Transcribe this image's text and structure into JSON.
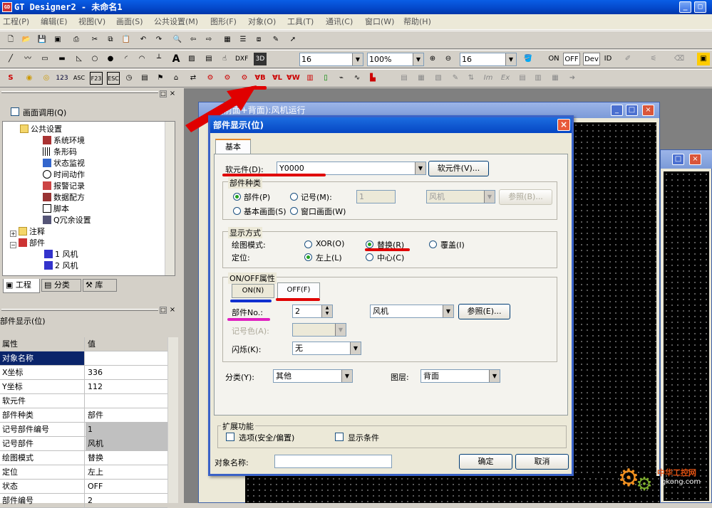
{
  "app": {
    "title": "GT Designer2 - 未命名1",
    "icon_label": "GD",
    "controls": [
      "_",
      "□",
      "×"
    ]
  },
  "menu": [
    "工程(P)",
    "编辑(E)",
    "视图(V)",
    "画面(S)",
    "公共设置(M)",
    "图形(F)",
    "对象(O)",
    "工具(T)",
    "通讯(C)",
    "窗口(W)",
    "帮助(H)"
  ],
  "toolbar2": {
    "font_size": "16",
    "zoom": "100%",
    "size2": "16",
    "on_label": "ON",
    "off_label": "OFF",
    "dev_label": "Dev",
    "id_label": "ID"
  },
  "toolbar3_text": [
    "S",
    "123",
    "ASC",
    "F23",
    "ESC"
  ],
  "left_panel": {
    "screen_call_label": "画面调用(Q)",
    "tree": [
      {
        "label": "公共设置",
        "level": 1
      },
      {
        "label": "系统环境",
        "level": 2
      },
      {
        "label": "条形码",
        "level": 2
      },
      {
        "label": "状态监视",
        "level": 2
      },
      {
        "label": "时间动作",
        "level": 2
      },
      {
        "label": "报警记录",
        "level": 2
      },
      {
        "label": "数据配方",
        "level": 2
      },
      {
        "label": "脚本",
        "level": 2
      },
      {
        "label": "Q冗余设置",
        "level": 2
      },
      {
        "label": "注释",
        "level": 1
      },
      {
        "label": "部件",
        "level": 1
      },
      {
        "label": "1 风机",
        "level": 2
      },
      {
        "label": "2 风机",
        "level": 2
      }
    ],
    "tabs": [
      "工程",
      "分类",
      "库"
    ]
  },
  "props": {
    "title": "部件显示(位)",
    "col_attr": "属性",
    "col_val": "值",
    "rows": [
      {
        "k": "对象名称",
        "v": ""
      },
      {
        "k": "X坐标",
        "v": "336"
      },
      {
        "k": "Y坐标",
        "v": "112"
      },
      {
        "k": "软元件",
        "v": ""
      },
      {
        "k": "部件种类",
        "v": "部件"
      },
      {
        "k": "记号部件编号",
        "v": "1"
      },
      {
        "k": "记号部件",
        "v": "风机"
      },
      {
        "k": "绘图模式",
        "v": "替换"
      },
      {
        "k": "定位",
        "v": "左上"
      },
      {
        "k": "状态",
        "v": "OFF"
      },
      {
        "k": "部件编号",
        "v": "2"
      }
    ]
  },
  "bg_window": {
    "title": "(前面+背面):风机运行"
  },
  "dialog": {
    "title": "部件显示(位)",
    "tab": "基本",
    "device_label": "软元件(D):",
    "device_value": "Y0000",
    "device_btn": "软元件(V)...",
    "parts_type_group": "部件种类",
    "opt_part": "部件(P)",
    "opt_mark": "记号(M):",
    "mark_num": "1",
    "mark_name": "风机",
    "ref_btn_disabled": "参照(B)...",
    "opt_base_screen": "基本画面(S)",
    "opt_window_screen": "窗口画面(W)",
    "display_group": "显示方式",
    "draw_mode_label": "绘图模式:",
    "xor": "XOR(O)",
    "replace": "替换(R)",
    "overlay": "覆盖(I)",
    "position_label": "定位:",
    "top_left": "左上(L)",
    "center": "中心(C)",
    "onoff_group": "ON/OFF属性",
    "on_tab": "ON(N)",
    "off_tab": "OFF(F)",
    "part_no_label": "部件No.:",
    "part_no_value": "2",
    "part_name": "风机",
    "ref_btn": "参照(E)...",
    "mark_color_label": "记号色(A):",
    "blink_label": "闪烁(K):",
    "blink_value": "无",
    "category_label": "分类(Y):",
    "category_value": "其他",
    "layer_label": "图层:",
    "layer_value": "背面",
    "ext_group": "扩展功能",
    "opt_option": "选项(安全/偏置)",
    "opt_display_cond": "显示条件",
    "obj_name_label": "对象名称:",
    "ok": "确定",
    "cancel": "取消"
  },
  "watermark": {
    "line1": "中华工控网",
    "line2": "gkong.com"
  },
  "colors": {
    "annotation_red": "#e00000",
    "annotation_blue": "#1030d0",
    "annotation_magenta": "#e020c0",
    "titlebar_blue": "#0546c3"
  }
}
